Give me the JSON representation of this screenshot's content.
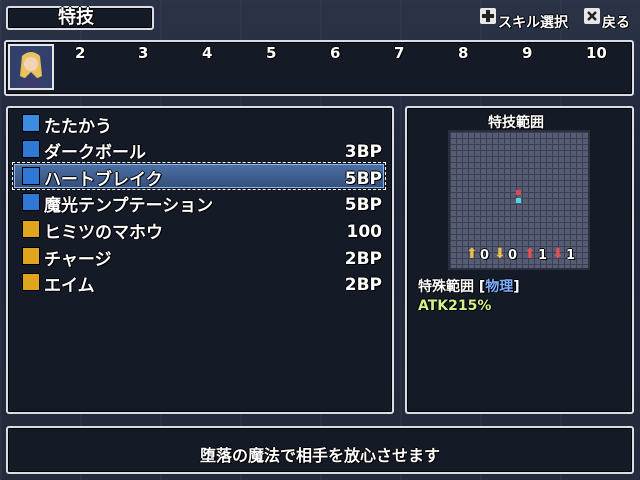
{
  "header": {
    "title": "特技",
    "hint_select": "スキル選択",
    "hint_back": "戻る",
    "select_icon": "dpad-icon",
    "back_icon": "x-button-icon"
  },
  "party": {
    "slot_numbers": [
      "2",
      "3",
      "4",
      "5",
      "6",
      "7",
      "8",
      "9",
      "10"
    ]
  },
  "skills": [
    {
      "name": "たたかう",
      "cost": "",
      "icon": "sword-icon",
      "icon_color": "#3a8de0"
    },
    {
      "name": "ダークボール",
      "cost": "3BP",
      "icon": "skill-icon",
      "icon_color": "#2f79d6"
    },
    {
      "name": "ハートブレイク",
      "cost": "5BP",
      "icon": "skill-icon",
      "icon_color": "#2f79d6",
      "selected": true
    },
    {
      "name": "魔光テンプテーション",
      "cost": "5BP",
      "icon": "skill-icon",
      "icon_color": "#2f79d6"
    },
    {
      "name": "ヒミツのマホウ",
      "cost": "100",
      "icon": "special-icon",
      "icon_color": "#e0a41e"
    },
    {
      "name": "チャージ",
      "cost": "2BP",
      "icon": "ui-icon",
      "icon_color": "#e0a41e"
    },
    {
      "name": "エイム",
      "cost": "2BP",
      "icon": "ui-icon",
      "icon_color": "#e0a41e"
    }
  ],
  "range_panel": {
    "title": "特技範囲",
    "counts": [
      "0",
      "0",
      "1",
      "1"
    ],
    "range_label": "特殊範囲 [",
    "range_type": "物理",
    "range_close": "]",
    "atk": "ATK215%"
  },
  "description": "堕落の魔法で相手を放心させます"
}
